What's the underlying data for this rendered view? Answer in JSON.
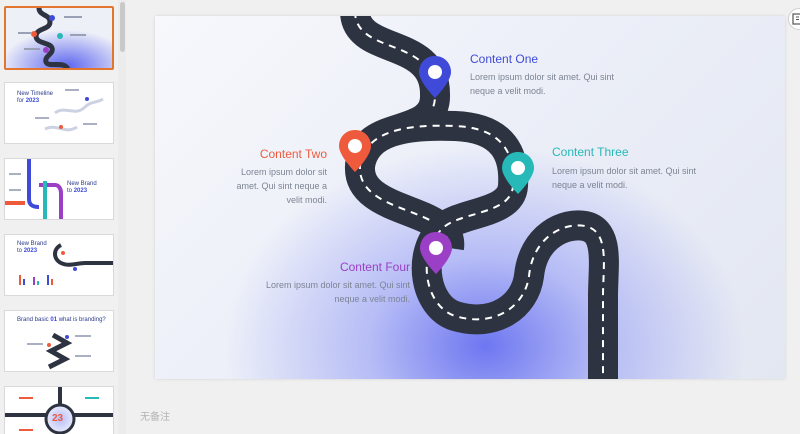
{
  "thumbnails": [
    {
      "title": "",
      "subtitle": ""
    },
    {
      "title": "New Timeline",
      "subtitle": "for",
      "year": "2023"
    },
    {
      "title": "New Brand",
      "subtitle": "to",
      "year": "2023"
    },
    {
      "title": "New Brand",
      "subtitle": "to",
      "year": "2023"
    },
    {
      "title": "Brand basic",
      "highlight": "01",
      "tail": "what is branding?"
    },
    {
      "badge": "23"
    }
  ],
  "slide": {
    "item1": {
      "title": "Content One",
      "body": "Lorem ipsum dolor sit amet. Qui sint neque a velit modi.",
      "color": "#3f4bd8"
    },
    "item2": {
      "title": "Content Two",
      "body": "Lorem ipsum dolor sit amet. Qui sint neque a velit modi.",
      "color": "#f05a3c"
    },
    "item3": {
      "title": "Content Three",
      "body": "Lorem ipsum dolor sit amet. Qui sint neque a velit modi.",
      "color": "#27b8b8"
    },
    "item4": {
      "title": "Content Four",
      "body": "Lorem ipsum dolor sit amet. Qui sint neque a velit modi.",
      "color": "#9b3fc7"
    }
  },
  "notes": {
    "placeholder": "无备注"
  },
  "colors": {
    "road": "#2d3340",
    "accent": "#e3762e"
  }
}
